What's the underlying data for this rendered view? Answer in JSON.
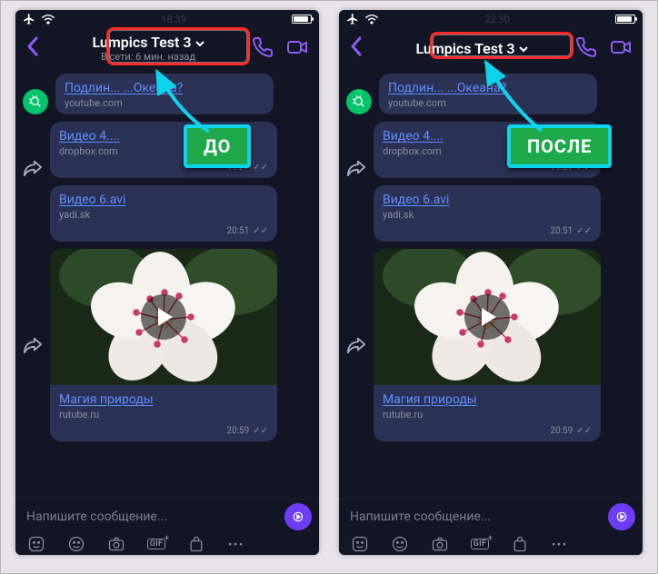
{
  "callouts": {
    "before": "ДО",
    "after": "ПОСЛЕ"
  },
  "left": {
    "statusbar": {
      "time": "18:39"
    },
    "navbar": {
      "title": "Lumpics Test 3",
      "subtitle": "В сети: 6 мин. назад"
    },
    "messages": {
      "m1": {
        "title": "Подлин... ...Океана?",
        "domain": "youtube.com"
      },
      "m2": {
        "title": "Видео 4....",
        "domain": "dropbox.com",
        "time": "19:27"
      },
      "m3": {
        "title": "Видео 6.avi",
        "domain": "yadi.sk",
        "time": "20:51"
      },
      "m4": {
        "title": "Магия природы",
        "domain": "rutube.ru",
        "time": "20:59"
      }
    },
    "input": {
      "placeholder": "Напишите сообщение..."
    },
    "attachments": {
      "gif": "GIF"
    }
  },
  "right": {
    "statusbar": {
      "time": "22:30"
    },
    "navbar": {
      "title": "Lumpics Test 3",
      "subtitle": ""
    },
    "messages": {
      "m1": {
        "title": "Подлин... ...Океана?",
        "domain": "youtube.com"
      },
      "m2": {
        "title": "Видео 4....",
        "domain": "dropbox.com",
        "time": "19:27"
      },
      "m3": {
        "title": "Видео 6.avi",
        "domain": "yadi.sk",
        "time": "20:51"
      },
      "m4": {
        "title": "Магия природы",
        "domain": "rutube.ru",
        "time": "20:59"
      }
    },
    "input": {
      "placeholder": "Напишите сообщение..."
    },
    "attachments": {
      "gif": "GIF"
    }
  }
}
